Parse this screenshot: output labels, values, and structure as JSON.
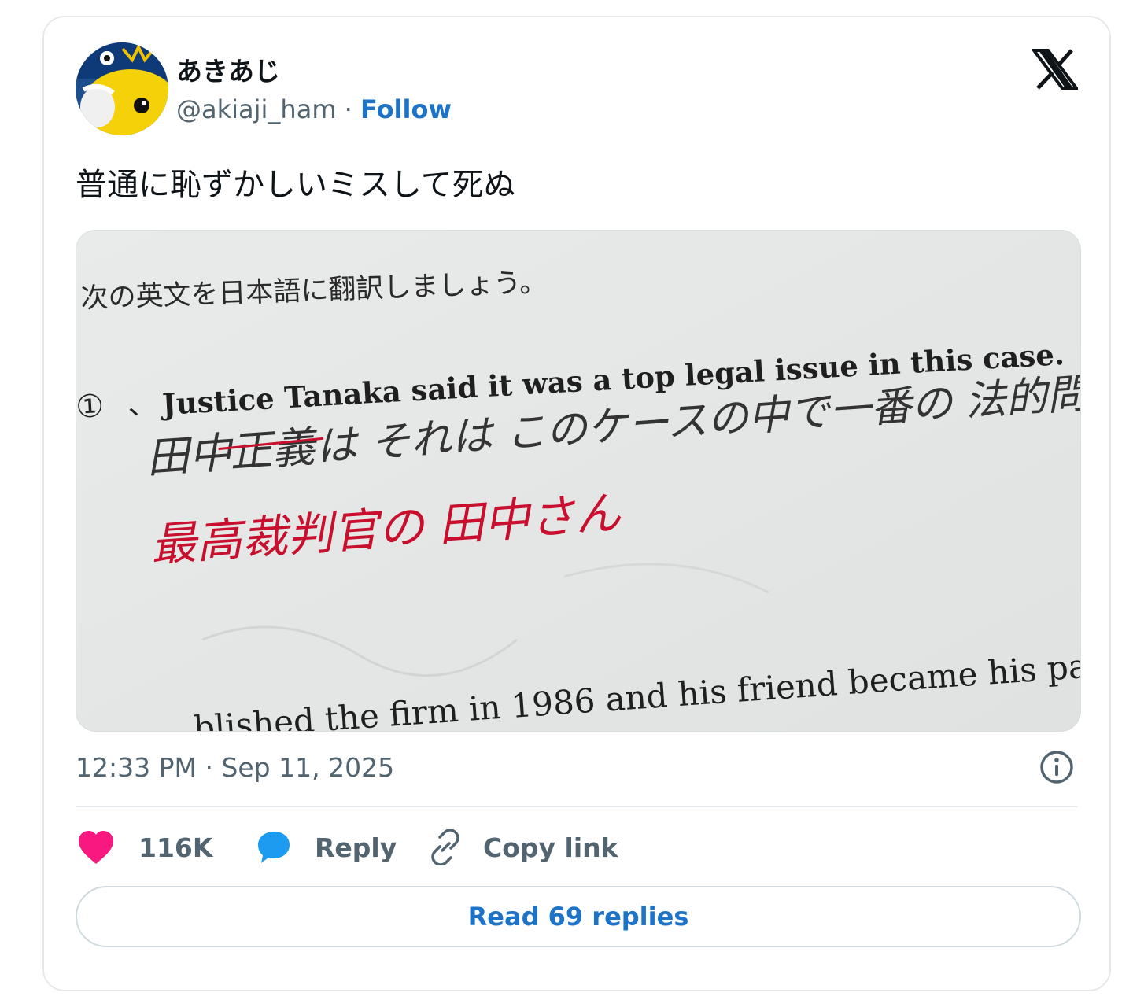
{
  "author": {
    "display_name": "あきあじ",
    "handle": "@akiaji_ham",
    "separator": " · ",
    "follow_label": "Follow"
  },
  "tweet": {
    "text": "普通に恥ずかしいミスして死ぬ",
    "timestamp": "12:33 PM · Sep 11, 2025"
  },
  "media": {
    "prompt": "次の英文を日本語に翻訳しましょう。",
    "question_number": "①",
    "question_mark": "、",
    "english_sentence": "Justice Tanaka said it was a top legal issue in this case.",
    "handwritten_answer_start": "田中",
    "handwritten_crossed": "正義",
    "handwritten_answer_rest": "は それは このケースの中で一番の 法的問題",
    "correction": "最高裁判官の 田中さん",
    "next_sentence": "...blished the firm in 1986 and his friend became his pa"
  },
  "actions": {
    "like_count": "116K",
    "reply_label": "Reply",
    "copy_label": "Copy link",
    "read_replies_label": "Read 69 replies"
  },
  "colors": {
    "like": "#f91880",
    "reply": "#1d9bf0",
    "link_blue": "#1d73c8",
    "muted": "#536471",
    "correction_red": "#c8102e"
  },
  "icons": {
    "brand": "x-logo-icon",
    "info": "info-icon",
    "like": "heart-icon",
    "reply": "speech-bubble-icon",
    "copy": "link-icon"
  }
}
